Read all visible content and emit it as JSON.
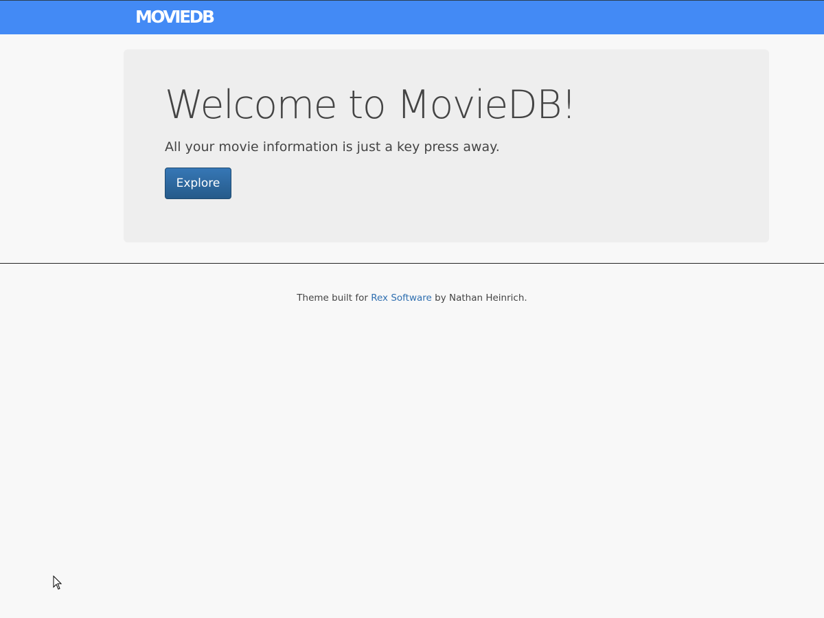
{
  "navbar": {
    "brand": "MOVIEDB",
    "color": "#438af5"
  },
  "jumbotron": {
    "title": "Welcome to MovieDB!",
    "lead": "All your movie information is just a key press away.",
    "button_label": "Explore",
    "button_color": "#2e6aa3"
  },
  "footer": {
    "prefix": "Theme built for ",
    "link_text": "Rex Software",
    "suffix": " by Nathan Heinrich."
  },
  "cursor": {
    "icon": "mouse-pointer-icon"
  }
}
